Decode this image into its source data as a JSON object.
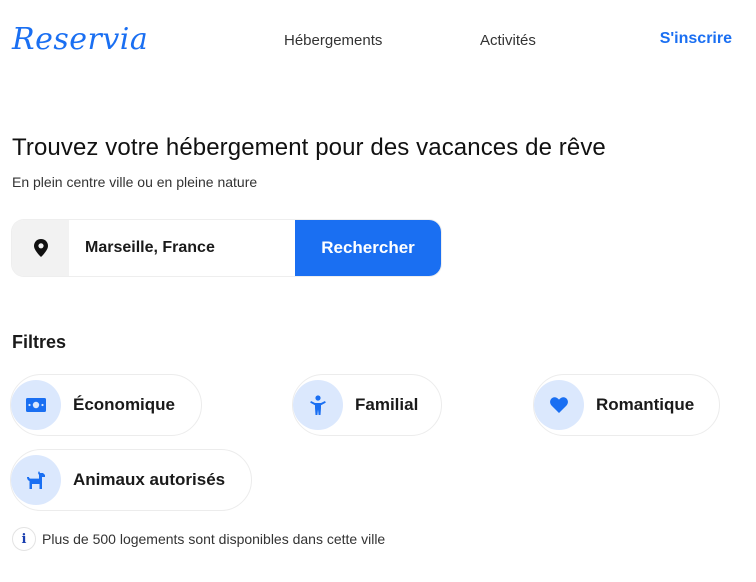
{
  "header": {
    "logo": "Reservia",
    "nav": [
      {
        "label": "Hébergements"
      },
      {
        "label": "Activités"
      }
    ],
    "signup_label": "S'inscrire"
  },
  "hero": {
    "title": "Trouvez votre hébergement pour des vacances de rêve",
    "subtitle": "En plein centre ville ou en pleine nature"
  },
  "search": {
    "icon": "map-marker-icon",
    "value": "Marseille, France",
    "button_label": "Rechercher"
  },
  "filters": {
    "title": "Filtres",
    "items": [
      {
        "label": "Économique",
        "icon": "money-bill-icon"
      },
      {
        "label": "Familial",
        "icon": "child-icon"
      },
      {
        "label": "Romantique",
        "icon": "heart-icon"
      },
      {
        "label": "Animaux autorisés",
        "icon": "dog-icon"
      }
    ]
  },
  "info": {
    "icon": "info-icon",
    "text": "Plus de 500 logements sont disponibles dans cette ville"
  },
  "colors": {
    "brand": "#1a6ff2",
    "chip_icon_bg": "#dbe8fd"
  }
}
